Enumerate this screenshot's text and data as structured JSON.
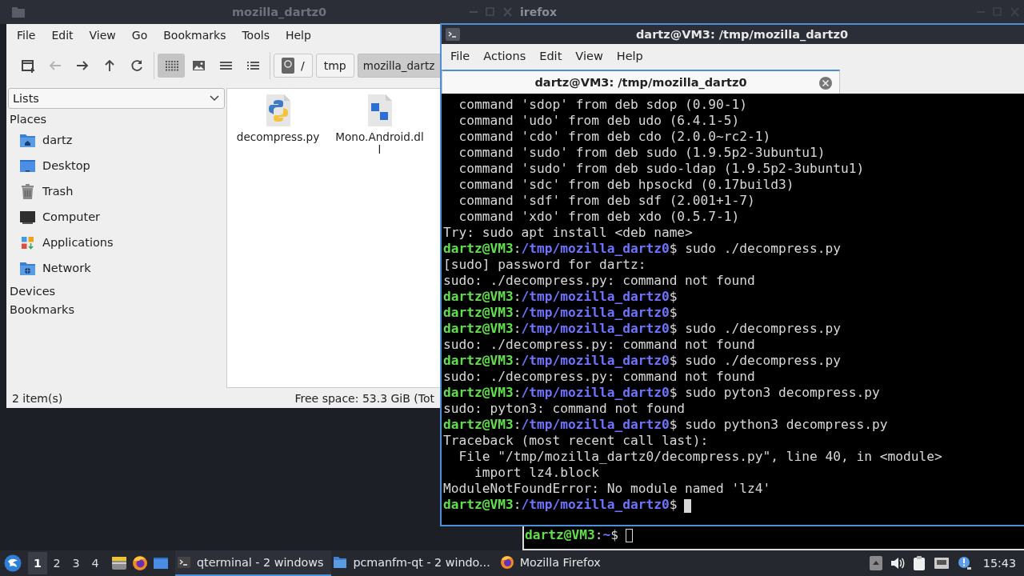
{
  "file_manager": {
    "title": "mozilla_dartz0",
    "menu": [
      "File",
      "Edit",
      "View",
      "Go",
      "Bookmarks",
      "Tools",
      "Help"
    ],
    "nav": [
      {
        "disabled": false
      },
      {
        "disabled": true
      },
      {
        "disabled": false
      },
      {
        "disabled": false
      },
      {
        "disabled": false
      }
    ],
    "view_modes": [
      {
        "selected": true
      },
      {
        "selected": false
      },
      {
        "selected": false
      },
      {
        "selected": false
      }
    ],
    "path": [
      {
        "label": "/",
        "selected": false
      },
      {
        "label": "tmp",
        "selected": false
      },
      {
        "label": "mozilla_dartz",
        "selected": true
      }
    ],
    "side_select": "Lists",
    "sections": [
      {
        "label": "Places",
        "children": [
          {
            "label": "dartz"
          },
          {
            "label": "Desktop"
          },
          {
            "label": "Trash"
          },
          {
            "label": "Computer"
          },
          {
            "label": "Applications"
          },
          {
            "label": "Network"
          }
        ]
      },
      {
        "label": "Devices"
      },
      {
        "label": "Bookmarks"
      }
    ],
    "files": [
      {
        "name": "decompress.py"
      },
      {
        "name": "Mono.Android.dll"
      }
    ],
    "status": {
      "items": "2 item(s)",
      "free_space": "Free space: 53.3 GiB (Tot"
    }
  },
  "background_window": {
    "title": "irefox"
  },
  "terminal": {
    "title": "dartz@VM3: /tmp/mozilla_dartz0",
    "menu": [
      "File",
      "Actions",
      "Edit",
      "View",
      "Help"
    ],
    "tabs": [
      {
        "label": "dartz@VM3: /tmp/mozilla_dartz0",
        "selected": true
      }
    ],
    "lines": [
      {
        "kind": "output",
        "text": "  command 'sdop' from deb sdop (0.90-1)"
      },
      {
        "kind": "output",
        "text": "  command 'udo' from deb udo (6.4.1-5)"
      },
      {
        "kind": "output",
        "text": "  command 'cdo' from deb cdo (2.0.0~rc2-1)"
      },
      {
        "kind": "output",
        "text": "  command 'sudo' from deb sudo (1.9.5p2-3ubuntu1)"
      },
      {
        "kind": "output",
        "text": "  command 'sudo' from deb sudo-ldap (1.9.5p2-3ubuntu1)"
      },
      {
        "kind": "output",
        "text": "  command 'sdc' from deb hpsockd (0.17build3)"
      },
      {
        "kind": "output",
        "text": "  command 'sdf' from deb sdf (2.001+1-7)"
      },
      {
        "kind": "output",
        "text": "  command 'xdo' from deb xdo (0.5.7-1)"
      },
      {
        "kind": "output",
        "text": "Try: sudo apt install <deb name>"
      },
      {
        "kind": "prompt",
        "user": "dartz@VM3",
        "separator": ":",
        "path": "/tmp/mozilla_dartz0",
        "text": "$ sudo ./decompress.py",
        "cursor": false
      },
      {
        "kind": "output",
        "text": "[sudo] password for dartz:"
      },
      {
        "kind": "output",
        "text": "sudo: ./decompress.py: command not found"
      },
      {
        "kind": "prompt",
        "user": "dartz@VM3",
        "separator": ":",
        "path": "/tmp/mozilla_dartz0",
        "text": "$",
        "cursor": false
      },
      {
        "kind": "prompt",
        "user": "dartz@VM3",
        "separator": ":",
        "path": "/tmp/mozilla_dartz0",
        "text": "$",
        "cursor": false
      },
      {
        "kind": "prompt",
        "user": "dartz@VM3",
        "separator": ":",
        "path": "/tmp/mozilla_dartz0",
        "text": "$ sudo ./decompress.py",
        "cursor": false
      },
      {
        "kind": "output",
        "text": "sudo: ./decompress.py: command not found"
      },
      {
        "kind": "prompt",
        "user": "dartz@VM3",
        "separator": ":",
        "path": "/tmp/mozilla_dartz0",
        "text": "$ sudo ./decompress.py",
        "cursor": false
      },
      {
        "kind": "output",
        "text": "sudo: ./decompress.py: command not found"
      },
      {
        "kind": "prompt",
        "user": "dartz@VM3",
        "separator": ":",
        "path": "/tmp/mozilla_dartz0",
        "text": "$ sudo pyton3 decompress.py",
        "cursor": false
      },
      {
        "kind": "output",
        "text": "sudo: pyton3: command not found"
      },
      {
        "kind": "prompt",
        "user": "dartz@VM3",
        "separator": ":",
        "path": "/tmp/mozilla_dartz0",
        "text": "$ sudo python3 decompress.py",
        "cursor": false
      },
      {
        "kind": "output",
        "text": "Traceback (most recent call last):"
      },
      {
        "kind": "output",
        "text": "  File \"/tmp/mozilla_dartz0/decompress.py\", line 40, in <module>"
      },
      {
        "kind": "output",
        "text": "    import lz4.block"
      },
      {
        "kind": "output",
        "text": "ModuleNotFoundError: No module named 'lz4'"
      },
      {
        "kind": "prompt",
        "user": "dartz@VM3",
        "separator": ":",
        "path": "/tmp/mozilla_dartz0",
        "text": "$",
        "cursor": true
      }
    ]
  },
  "back_terminal": {
    "lines": [
      {
        "kind": "prompt",
        "user": "dartz@VM3",
        "separator": ":",
        "path": "~",
        "text": "$",
        "cursor": true
      }
    ]
  },
  "taskbar": {
    "workspaces": [
      {
        "label": "1",
        "selected": true
      },
      {
        "label": "2",
        "selected": false
      },
      {
        "label": "3",
        "selected": false
      },
      {
        "label": "4",
        "selected": false
      }
    ],
    "tasks": [
      {
        "label": "qterminal - 2 windows",
        "selected": true
      },
      {
        "label": "pcmanfm-qt - 2 windo...",
        "selected": false
      },
      {
        "label": "Mozilla Firefox",
        "selected": false
      }
    ],
    "clock": "15:43"
  }
}
